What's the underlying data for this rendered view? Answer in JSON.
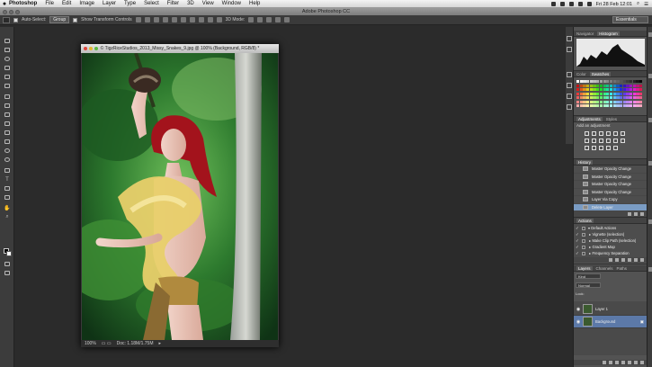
{
  "menubar": {
    "apple": "",
    "items": [
      "Photoshop",
      "File",
      "Edit",
      "Image",
      "Layer",
      "Type",
      "Select",
      "Filter",
      "3D",
      "View",
      "Window",
      "Help"
    ],
    "clock": "Fri 28 Feb  12:01"
  },
  "app_title": "Adobe Photoshop CC",
  "options_bar": {
    "auto_select_label": "Auto-Select:",
    "auto_select_value": "Group",
    "show_transform_label": "Show Transform Controls",
    "mode_label": "3D Mode:",
    "workspace": "Essentials"
  },
  "document": {
    "title": "© TigzRiceStudios_2013_Missy_Snakes_9.jpg @ 100% (Background, RGB/8) *",
    "zoom": "100%",
    "doc_size": "Doc: 1.18M/1.75M"
  },
  "panels": {
    "histogram_tabs": [
      "Navigator",
      "Histogram"
    ],
    "color_tabs": [
      "Color",
      "Swatches"
    ],
    "adjust_tabs": [
      "Adjustments",
      "Styles"
    ],
    "adjust_title": "Add an adjustment",
    "history_tab": "History",
    "history": [
      "Master Opacity Change",
      "Master Opacity Change",
      "Master Opacity Change",
      "Master Opacity Change",
      "Layer Via Copy",
      "Delete Layer"
    ],
    "actions_tab": "Actions",
    "actions": [
      "Default Actions",
      "Vignette (selection)",
      "Make Clip Path (selection)",
      "Gradient Map",
      "Frequency Separation"
    ],
    "layer_tabs": [
      "Layers",
      "Channels",
      "Paths"
    ],
    "layer_kind": "Kind",
    "layer_mode": "Normal",
    "layer_lock": "Lock:",
    "layers": [
      "Layer 1",
      "Background"
    ]
  },
  "colors": {
    "panel": "#535353",
    "selection": "#5c79a8",
    "canvas": "#2b2b2b"
  }
}
